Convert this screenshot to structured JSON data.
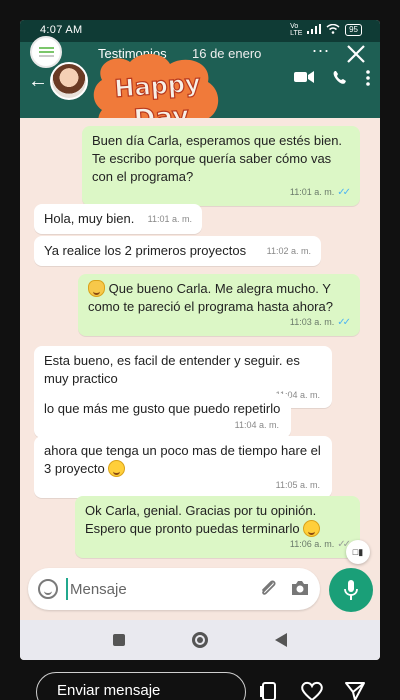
{
  "status": {
    "time": "4:07 AM",
    "network": "Vo LTE",
    "battery": "95"
  },
  "story": {
    "user": "Testimonios",
    "date": "16 de enero",
    "more": "...",
    "reply_placeholder": "Enviar mensaje"
  },
  "sticker": {
    "line1": "Happy",
    "line2": "Day"
  },
  "messages": [
    {
      "dir": "out",
      "text": "Buen día Carla, esperamos que estés bien. Te escribo porque quería saber cómo vas con el programa?",
      "time": "11:01 a. m.",
      "read": true
    },
    {
      "dir": "in",
      "text": "Hola, muy bien.",
      "time": "11:01 a. m."
    },
    {
      "dir": "in",
      "text": "Ya realice los 2 primeros proyectos",
      "time": "11:02 a. m."
    },
    {
      "dir": "out",
      "text": "Que bueno Carla. Me alegra mucho. Y como te pareció el programa hasta ahora?",
      "time": "11:03 a. m.",
      "read": true
    },
    {
      "dir": "in",
      "text": "Esta bueno, es facil de entender y seguir. es muy practico",
      "time": "11:04 a. m."
    },
    {
      "dir": "in",
      "text": "lo que más me gusto que puedo repetirlo",
      "time": "11:04 a. m."
    },
    {
      "dir": "in",
      "text": "ahora que tenga un poco mas de tiempo hare el 3 proyecto",
      "time": "11:05 a. m."
    },
    {
      "dir": "out",
      "text": "Ok Carla, genial. Gracias por tu opinión. Espero que pronto puedas terminarlo",
      "time": "11:06 a. m.",
      "read": true
    }
  ],
  "composer": {
    "placeholder": "Mensaje"
  },
  "colors": {
    "header": "#1e5f54",
    "outgoing_bubble": "#dcf7c6",
    "incoming_bubble": "#ffffff",
    "chat_background": "#f8e7df",
    "mic_button": "#1a9f78",
    "read_ticks": "#4fb4f2"
  }
}
